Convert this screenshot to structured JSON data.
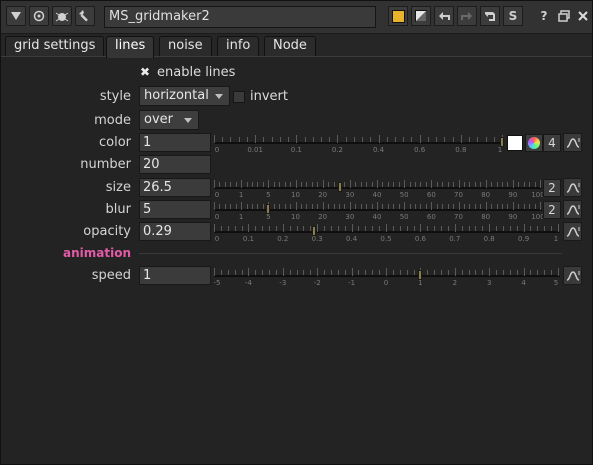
{
  "titlebar": {
    "node_name": "MS_gridmaker2",
    "help_label": "?",
    "s_label": "S"
  },
  "tabs": [
    {
      "label": "grid settings"
    },
    {
      "label": "lines"
    },
    {
      "label": "noise"
    },
    {
      "label": "info"
    },
    {
      "label": "Node"
    }
  ],
  "params": {
    "enable_lines": {
      "label": "enable lines",
      "checked": true
    },
    "style": {
      "label": "style",
      "value": "horizontal"
    },
    "invert": {
      "label": "invert",
      "checked": false
    },
    "mode": {
      "label": "mode",
      "value": "over"
    },
    "color": {
      "label": "color",
      "value": "1",
      "channels": "4",
      "slider_value": 1.0
    },
    "number": {
      "label": "number",
      "value": "20"
    },
    "size": {
      "label": "size",
      "value": "26.5",
      "channels": "2",
      "slider_value": 26.5
    },
    "blur": {
      "label": "blur",
      "value": "5",
      "channels": "2",
      "slider_value": 5
    },
    "opacity": {
      "label": "opacity",
      "value": "0.29",
      "slider_value": 0.29
    },
    "animation_section": "animation",
    "speed": {
      "label": "speed",
      "value": "1",
      "slider_value": 1
    }
  },
  "scales": {
    "color": [
      "0",
      "0.01",
      "0.1",
      "0.2",
      "0.4",
      "0.6",
      "0.8",
      "1"
    ],
    "size": [
      "0",
      "1",
      "5",
      "10",
      "20",
      "30",
      "40",
      "50",
      "60",
      "70",
      "80",
      "90",
      "100"
    ],
    "blur": [
      "0",
      "1",
      "5",
      "10",
      "20",
      "30",
      "40",
      "50",
      "60",
      "70",
      "80",
      "90",
      "100"
    ],
    "opacity": [
      "0",
      "0.1",
      "0.2",
      "0.3",
      "0.4",
      "0.5",
      "0.6",
      "0.7",
      "0.8",
      "0.9",
      "1"
    ],
    "speed": [
      "-5",
      "-4",
      "-3",
      "-2",
      "-1",
      "0",
      "1",
      "2",
      "3",
      "4",
      "5"
    ]
  },
  "colors": {
    "accent_yellow": "#e8b22a",
    "section_pink": "#e35ba6"
  }
}
